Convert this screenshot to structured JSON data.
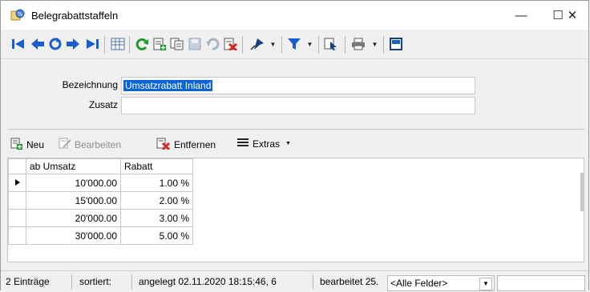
{
  "window": {
    "title": "Belegrabattstaffeln",
    "minimize": "—",
    "maximize": "☐",
    "close": "✕"
  },
  "toolbar": {
    "icons": [
      "first-record-icon",
      "previous-record-icon",
      "refresh-icon",
      "next-record-icon",
      "last-record-icon",
      "table-view-icon",
      "reload-icon",
      "new-record-icon",
      "copy-record-icon",
      "save-icon",
      "undo-icon",
      "delete-icon",
      "pin-icon",
      "filter-icon",
      "select-icon",
      "print-icon",
      "close-window-icon"
    ]
  },
  "form": {
    "bezeichnung_label": "Bezeichnung",
    "bezeichnung_value": "Umsatzrabatt Inland",
    "zusatz_label": "Zusatz",
    "zusatz_value": ""
  },
  "list_toolbar": {
    "new_label": "Neu",
    "edit_label": "Bearbeiten",
    "remove_label": "Entfernen",
    "extras_label": "Extras"
  },
  "grid": {
    "columns": [
      "ab Umsatz",
      "Rabatt"
    ],
    "rows": [
      {
        "umsatz": "10'000.00",
        "rabatt": "1.00 %"
      },
      {
        "umsatz": "15'000.00",
        "rabatt": "2.00 %"
      },
      {
        "umsatz": "20'000.00",
        "rabatt": "3.00 %"
      },
      {
        "umsatz": "30'000.00",
        "rabatt": "5.00 %"
      }
    ]
  },
  "status": {
    "entries": "2 Einträge",
    "sorted": "sortiert:",
    "created": "angelegt 02.11.2020 18:15:46, 6",
    "edited": "bearbeitet 25.",
    "field_select": "<Alle Felder>",
    "search_value": ""
  },
  "colors": {
    "accent_blue": "#1a5fd0",
    "selection": "#0a64d8",
    "refresh_green": "#1e9a2a",
    "delete_red": "#d22a1e"
  }
}
